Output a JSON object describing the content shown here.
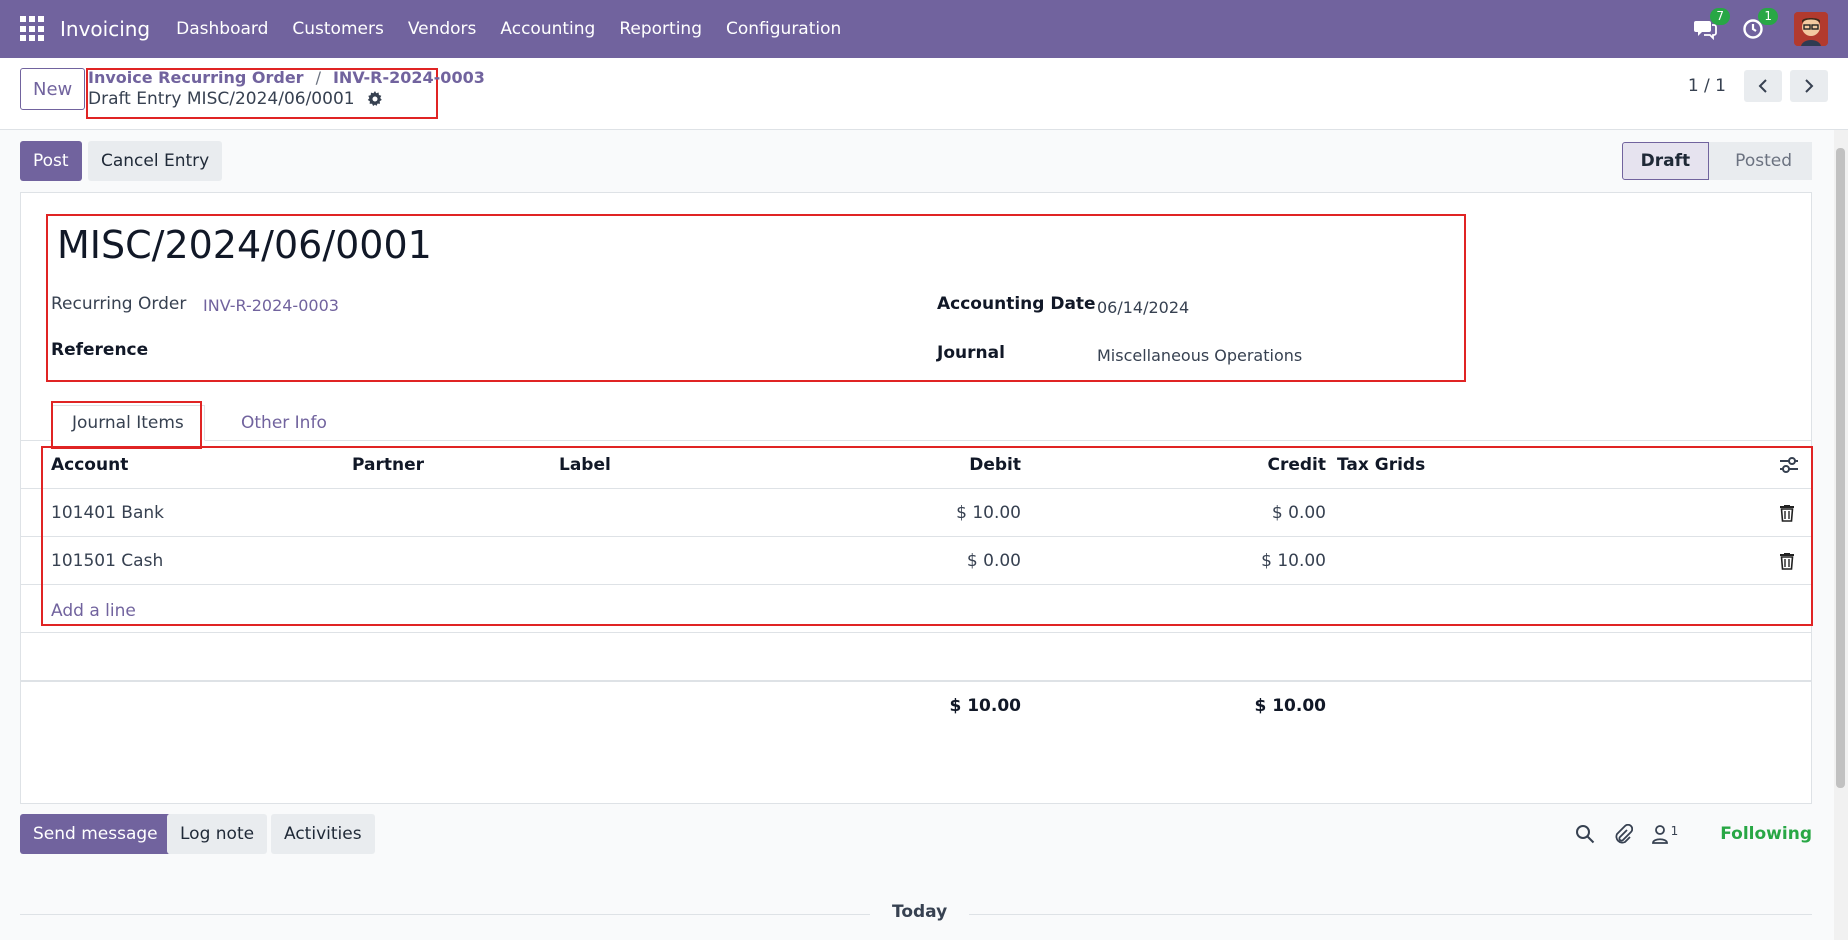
{
  "navbar": {
    "app_name": "Invoicing",
    "menu": [
      "Dashboard",
      "Customers",
      "Vendors",
      "Accounting",
      "Reporting",
      "Configuration"
    ],
    "messages_count": "7",
    "activities_count": "1"
  },
  "control": {
    "new_label": "New",
    "breadcrumb": [
      "Invoice Recurring Order",
      "INV-R-2024-0003"
    ],
    "breadcrumb_sep": "/",
    "record_title": "Draft Entry MISC/2024/06/0001",
    "pager": "1 / 1"
  },
  "actions": {
    "post_label": "Post",
    "cancel_label": "Cancel Entry",
    "status": [
      "Draft",
      "Posted"
    ]
  },
  "form": {
    "name": "MISC/2024/06/0001",
    "recurring_order_label": "Recurring Order",
    "recurring_order_value": "INV-R-2024-0003",
    "reference_label": "Reference",
    "accounting_date_label": "Accounting Date",
    "accounting_date_value": "06/14/2024",
    "journal_label": "Journal",
    "journal_value": "Miscellaneous Operations"
  },
  "tabs": [
    "Journal Items",
    "Other Info"
  ],
  "table": {
    "headers": {
      "account": "Account",
      "partner": "Partner",
      "label": "Label",
      "debit": "Debit",
      "credit": "Credit",
      "tax_grids": "Tax Grids"
    },
    "rows": [
      {
        "account": "101401 Bank",
        "debit": "$ 10.00",
        "credit": "$ 0.00"
      },
      {
        "account": "101501 Cash",
        "debit": "$ 0.00",
        "credit": "$ 10.00"
      }
    ],
    "add_line": "Add a line",
    "total_debit": "$ 10.00",
    "total_credit": "$ 10.00"
  },
  "chatter": {
    "send_message": "Send message",
    "log_note": "Log note",
    "activities": "Activities",
    "followers_count": "1",
    "following": "Following",
    "today": "Today"
  },
  "colors": {
    "brand": "#71639e",
    "highlight": "#e02424",
    "badge": "#28a745"
  }
}
